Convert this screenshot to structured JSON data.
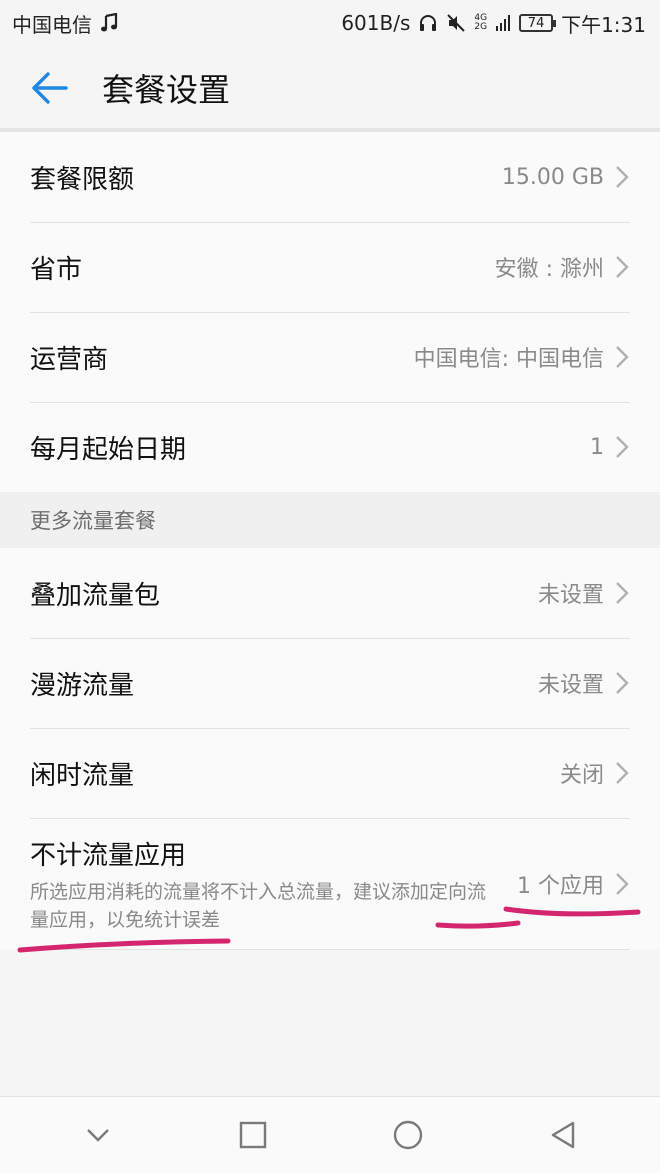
{
  "status_bar": {
    "carrier": "中国电信",
    "speed": "601B/s",
    "net_top": "4G",
    "net_bottom": "2G",
    "battery": "74",
    "time": "下午1:31"
  },
  "header": {
    "title": "套餐设置"
  },
  "settings": [
    {
      "label": "套餐限额",
      "value": "15.00 GB"
    },
    {
      "label": "省市",
      "value": "安徽 : 滁州"
    },
    {
      "label": "运营商",
      "value": "中国电信: 中国电信"
    },
    {
      "label": "每月起始日期",
      "value": "1"
    }
  ],
  "more_section": {
    "title": "更多流量套餐",
    "items": [
      {
        "label": "叠加流量包",
        "value": "未设置"
      },
      {
        "label": "漫游流量",
        "value": "未设置"
      },
      {
        "label": "闲时流量",
        "value": "关闭"
      },
      {
        "label": "不计流量应用",
        "description": "所选应用消耗的流量将不计入总流量，建议添加定向流量应用，以免统计误差",
        "value": "1 个应用"
      }
    ]
  },
  "colors": {
    "accent": "#1e88e5",
    "annotation": "#d4266f"
  },
  "icons": {
    "back": "back-arrow-icon",
    "chevron": "chevron-right-icon",
    "music": "music-note-icon",
    "headset": "headset-icon",
    "mute": "mute-icon",
    "signal": "signal-icon",
    "battery": "battery-icon",
    "nav": [
      "chevron-down-icon",
      "square-icon",
      "circle-icon",
      "triangle-back-icon"
    ]
  }
}
